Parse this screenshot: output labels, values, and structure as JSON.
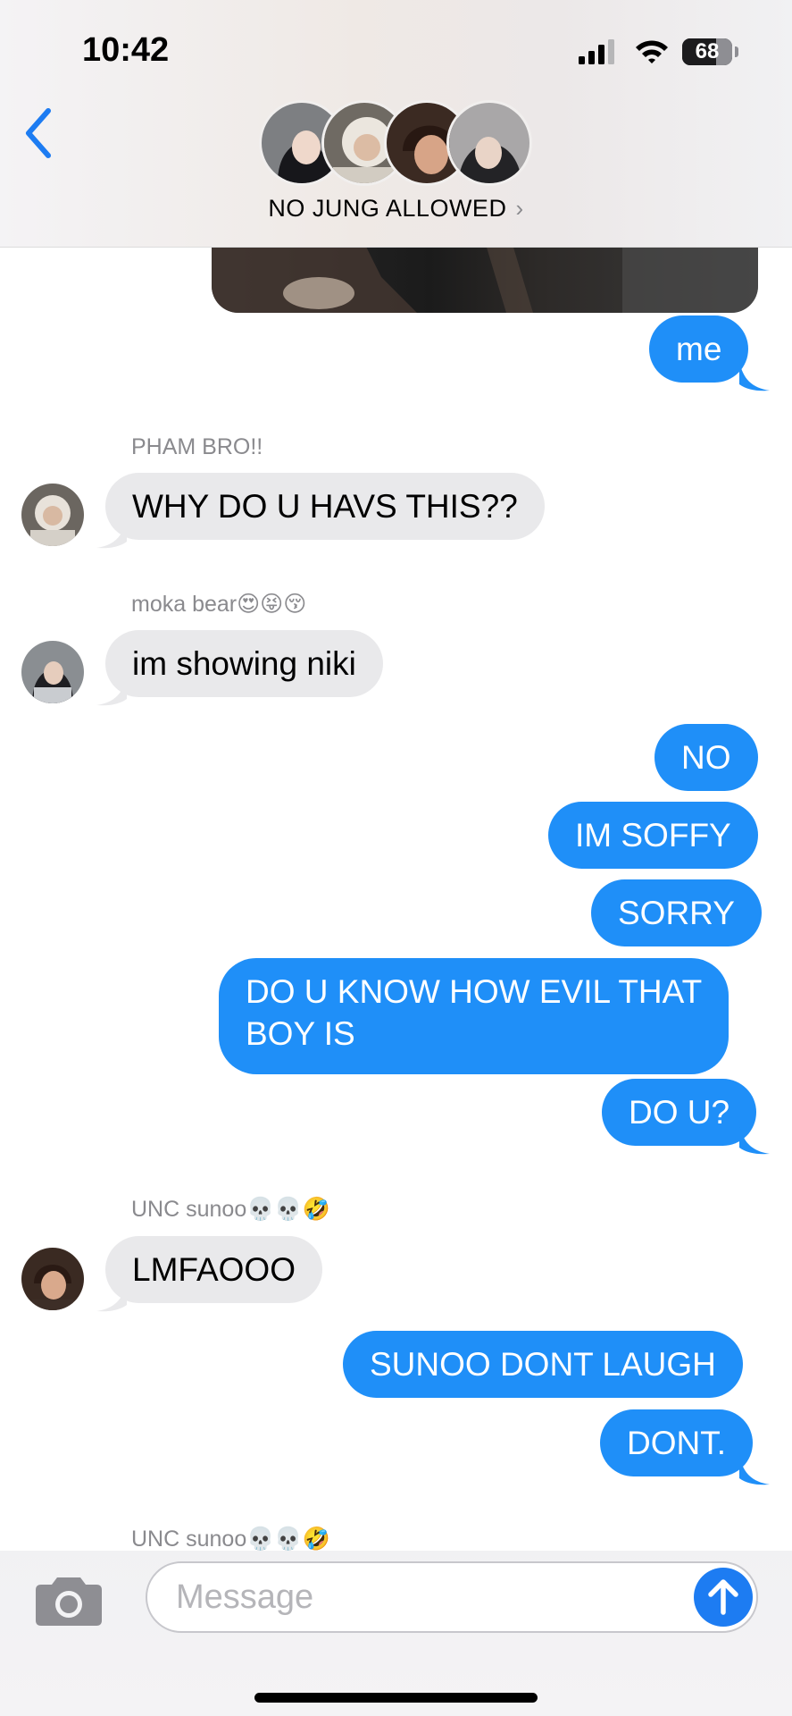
{
  "status_bar": {
    "time": "10:42",
    "battery": "68",
    "battery_level_percent": 68
  },
  "header": {
    "group_name": "NO JUNG ALLOWED"
  },
  "conversation": {
    "messages": [
      {
        "from": "me",
        "text": "me"
      },
      {
        "from": "PHAM BRO!!",
        "sender_label": "PHAM BRO!!",
        "text": "WHY DO U HAVS THIS??"
      },
      {
        "from": "moka bear",
        "sender_label": "moka bear😍😝😚",
        "text": "im showing niki"
      },
      {
        "from": "me",
        "text": "NO"
      },
      {
        "from": "me",
        "text": "IM SOFFY"
      },
      {
        "from": "me",
        "text": "SORRY"
      },
      {
        "from": "me",
        "text_line1": "DO U KNOW HOW EVIL THAT",
        "text_line2": "BOY IS"
      },
      {
        "from": "me",
        "text": "DO U?"
      },
      {
        "from": "UNC sunoo",
        "sender_label": "UNC sunoo💀💀🤣",
        "text": "LMFAOOO"
      },
      {
        "from": "me",
        "text": "SUNOO DONT LAUGH"
      },
      {
        "from": "me",
        "text": "DONT."
      }
    ],
    "next_sender_label": "UNC sunoo💀💀🤣"
  },
  "compose": {
    "placeholder": "Message"
  },
  "colors": {
    "outgoing_bubble": "#1f8ff8",
    "incoming_bubble": "#e9e9eb",
    "accent": "#1d7cf2"
  },
  "icons": [
    "back-chevron-icon",
    "signal-icon",
    "wifi-icon",
    "battery-icon",
    "camera-icon",
    "send-arrow-icon"
  ]
}
